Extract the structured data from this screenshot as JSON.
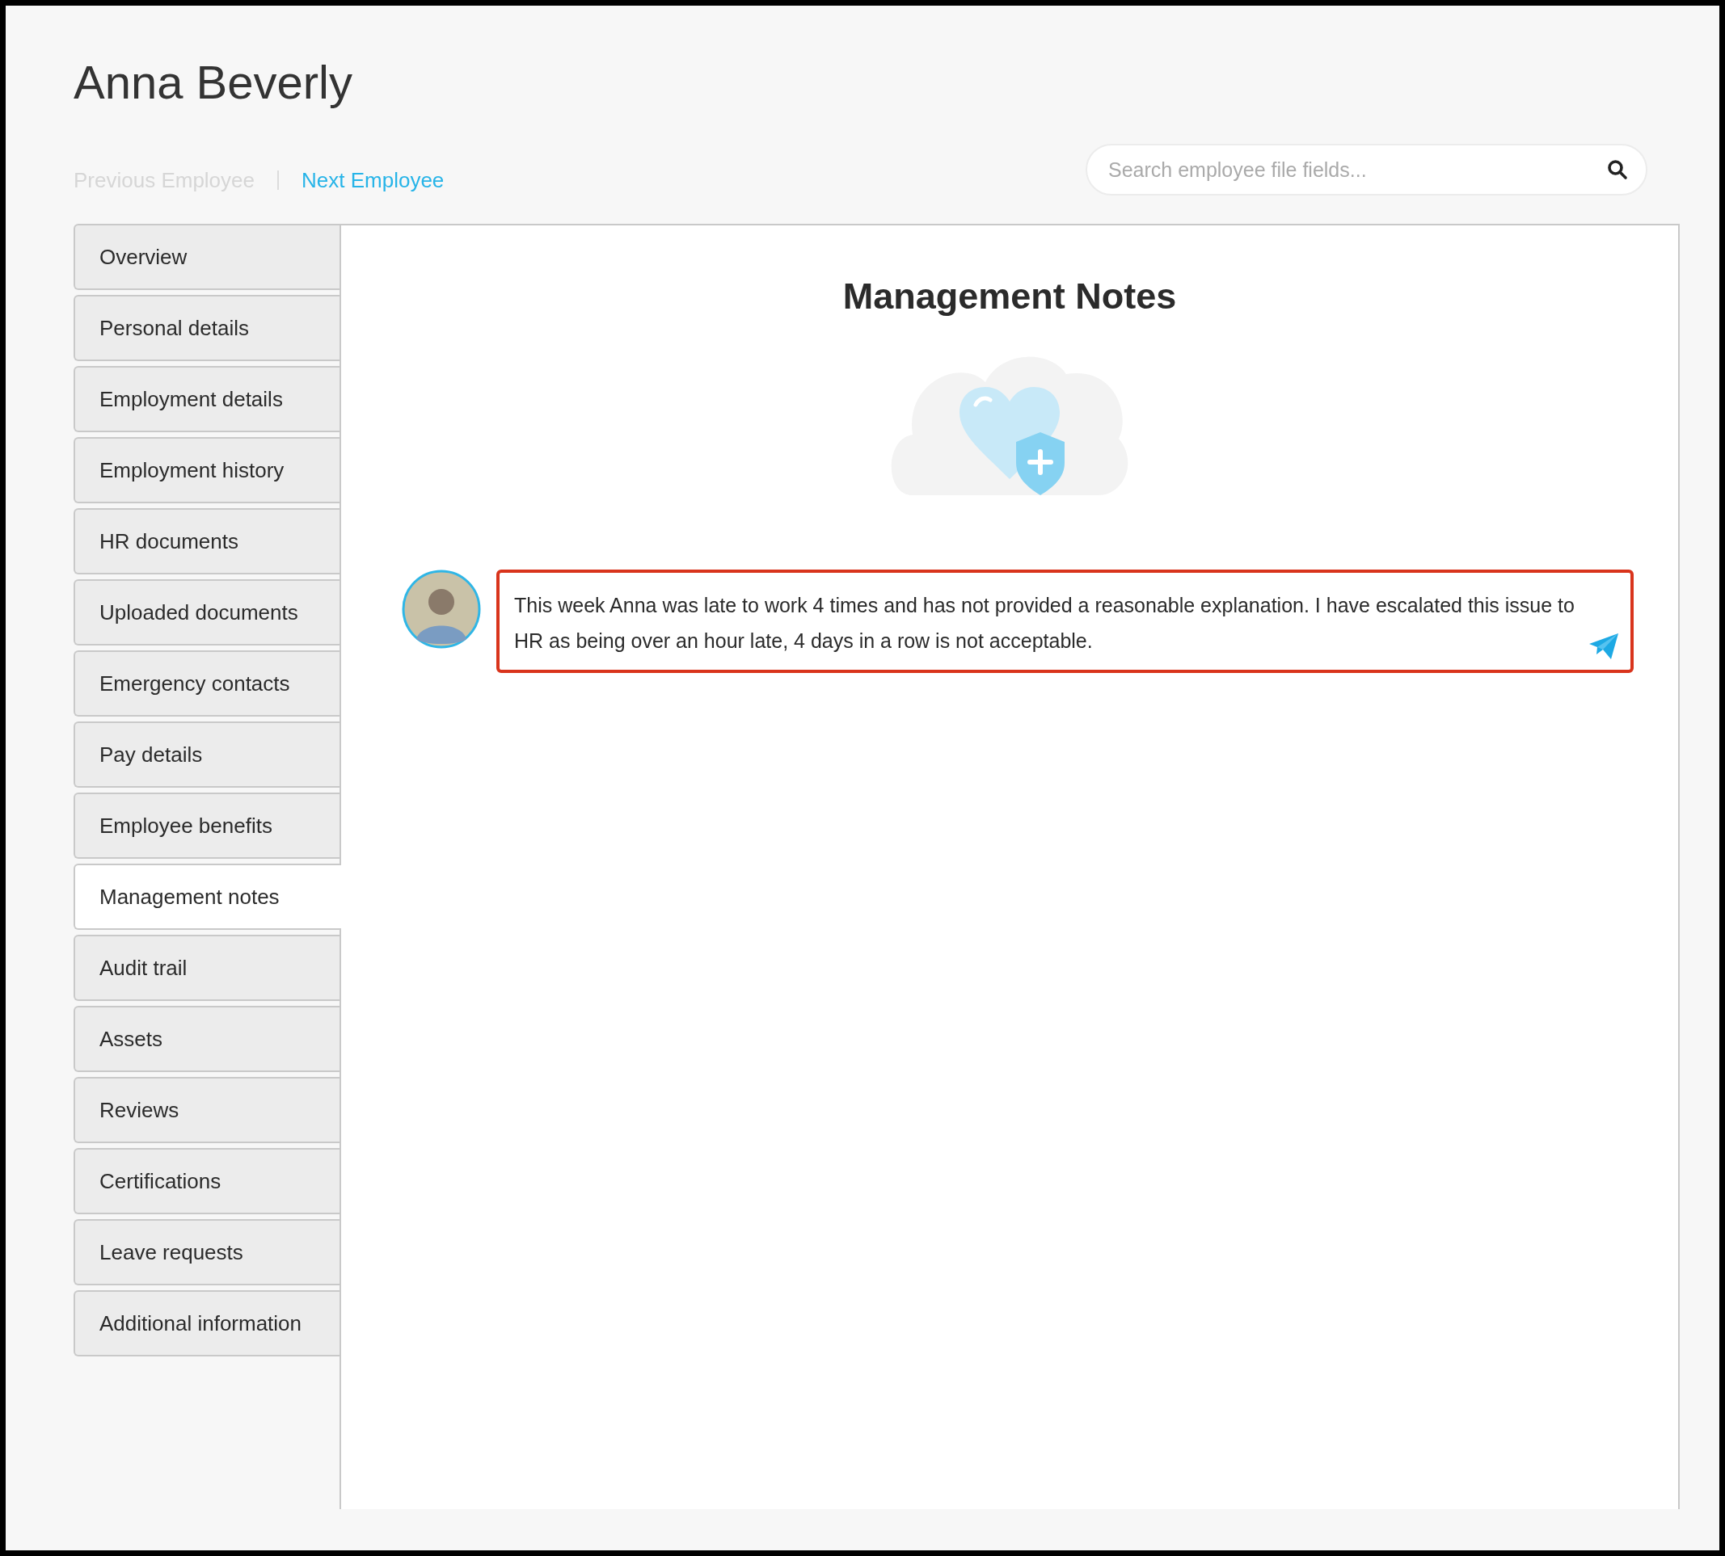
{
  "employee": {
    "name": "Anna Beverly"
  },
  "navigation": [
    {
      "label": "Previous Employee",
      "disabled": true
    },
    {
      "label": "Next Employee",
      "disabled": false
    }
  ],
  "search": {
    "placeholder": "Search employee file fields..."
  },
  "sidebar": {
    "items": [
      {
        "label": "Overview",
        "selected": false
      },
      {
        "label": "Personal details",
        "selected": false
      },
      {
        "label": "Employment details",
        "selected": false
      },
      {
        "label": "Employment history",
        "selected": false
      },
      {
        "label": "HR documents",
        "selected": false
      },
      {
        "label": "Uploaded documents",
        "selected": false
      },
      {
        "label": "Emergency contacts",
        "selected": false
      },
      {
        "label": "Pay details",
        "selected": false
      },
      {
        "label": "Employee benefits",
        "selected": false
      },
      {
        "label": "Management notes",
        "selected": true
      },
      {
        "label": "Audit trail",
        "selected": false
      },
      {
        "label": "Assets",
        "selected": false
      },
      {
        "label": "Reviews",
        "selected": false
      },
      {
        "label": "Certifications",
        "selected": false
      },
      {
        "label": "Leave requests",
        "selected": false
      },
      {
        "label": "Additional information",
        "selected": false
      }
    ]
  },
  "content": {
    "title": "Management Notes",
    "note": {
      "value": "This week Anna was late to work 4 times and has not provided a reasonable explanation. I have escalated this issue to HR as being over an hour late, 4 days in a row is not acceptable.",
      "error": true
    }
  }
}
